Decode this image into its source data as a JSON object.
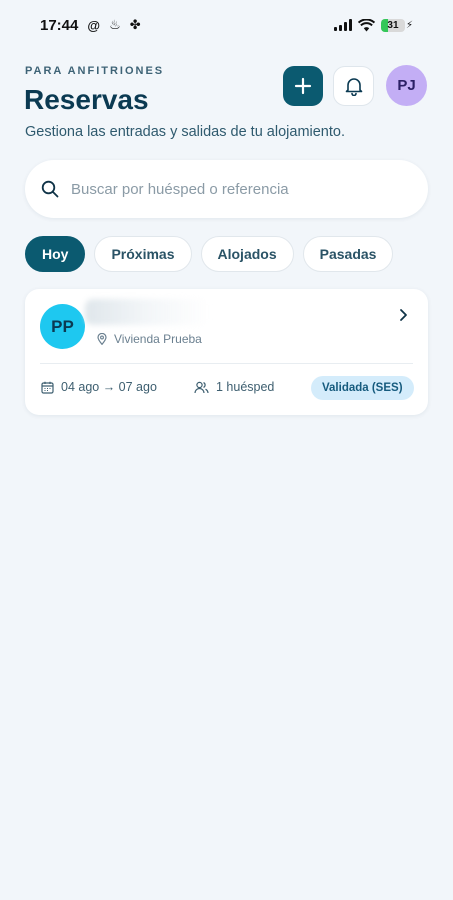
{
  "status_bar": {
    "time": "17:44",
    "battery": "31"
  },
  "header": {
    "eyebrow": "PARA ANFITRIONES",
    "title": "Reservas",
    "subtitle": "Gestiona las entradas y salidas de tu alojamiento.",
    "avatar_initials": "PJ"
  },
  "search": {
    "placeholder": "Buscar por huésped o referencia",
    "value": ""
  },
  "tabs": [
    {
      "label": "Hoy",
      "active": true
    },
    {
      "label": "Próximas",
      "active": false
    },
    {
      "label": "Alojados",
      "active": false
    },
    {
      "label": "Pasadas",
      "active": false
    }
  ],
  "reservations": [
    {
      "initials": "PP",
      "property": "Vivienda Prueba",
      "dates": "04 ago → 07 ago",
      "guests": "1 huésped",
      "status": "Validada (SES)"
    }
  ],
  "colors": {
    "primary": "#0b5a70",
    "background": "#f2f6fa",
    "avatar_user": "#c3aef5",
    "avatar_guest": "#1ec8f0",
    "badge_bg": "#d4ecfb"
  }
}
